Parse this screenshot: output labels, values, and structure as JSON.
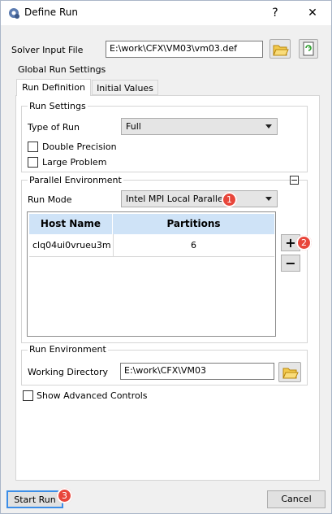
{
  "window": {
    "title": "Define Run",
    "help_glyph": "?",
    "close_glyph": "✕"
  },
  "solver": {
    "label": "Solver Input File",
    "value": "E:\\work\\CFX\\VM03\\vm03.def"
  },
  "global": {
    "label": "Global Run Settings",
    "tabs": [
      {
        "label": "Run Definition",
        "active": true
      },
      {
        "label": "Initial Values",
        "active": false
      }
    ]
  },
  "run_settings": {
    "label": "Run Settings",
    "type_of_run_label": "Type of Run",
    "type_of_run_value": "Full",
    "double_precision_label": "Double Precision",
    "double_precision_checked": false,
    "large_problem_label": "Large Problem",
    "large_problem_checked": false
  },
  "parallel": {
    "label": "Parallel Environment",
    "collapse_glyph": "−",
    "run_mode_label": "Run Mode",
    "run_mode_value": "Intel MPI Local Parallel",
    "table": {
      "headers": [
        "Host Name",
        "Partitions"
      ],
      "rows": [
        {
          "host": "clq04ui0vrueu3m",
          "partitions": "6"
        }
      ]
    },
    "add_glyph": "+",
    "remove_glyph": "−"
  },
  "run_env": {
    "label": "Run Environment",
    "working_dir_label": "Working Directory",
    "working_dir_value": "E:\\work\\CFX\\VM03"
  },
  "advanced": {
    "label": "Show Advanced Controls",
    "checked": false
  },
  "buttons": {
    "start": "Start Run",
    "cancel": "Cancel"
  },
  "annotations": [
    "1",
    "2",
    "3"
  ],
  "colors": {
    "badge": "#e8463b",
    "table_header": "#cfe3f7",
    "title_icon": "#3d5a8a"
  }
}
